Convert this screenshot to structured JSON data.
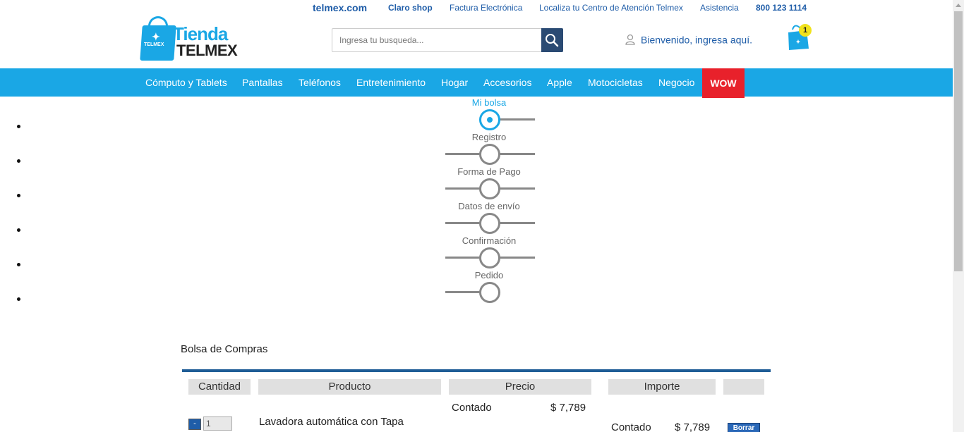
{
  "top_links": [
    {
      "label": "telmex.com"
    },
    {
      "label": "Claro shop"
    },
    {
      "label": "Factura Electrónica"
    },
    {
      "label": "Localiza tu Centro de Atención Telmex"
    },
    {
      "label": "Asistencia"
    },
    {
      "label": "800 123 1114"
    }
  ],
  "logo": {
    "line1": "Tienda",
    "line2": "TELMEX",
    "bag_text": "TELMEX"
  },
  "search": {
    "placeholder": "Ingresa tu busqueda...",
    "icon": "search-icon"
  },
  "account": {
    "label": "Bienvenido, ingresa aquí.",
    "icon": "user-icon"
  },
  "cart": {
    "count": "1",
    "icon": "shopping-bag-icon"
  },
  "nav": {
    "items": [
      {
        "label": "Cómputo y Tablets"
      },
      {
        "label": "Pantallas"
      },
      {
        "label": "Teléfonos"
      },
      {
        "label": "Entretenimiento"
      },
      {
        "label": "Hogar"
      },
      {
        "label": "Accesorios"
      },
      {
        "label": "Apple"
      },
      {
        "label": "Motocicletas"
      },
      {
        "label": "Negocio"
      }
    ],
    "highlight": {
      "label": "WOW"
    }
  },
  "steps": [
    {
      "label": "Mi bolsa",
      "active": true
    },
    {
      "label": "Registro",
      "active": false
    },
    {
      "label": "Forma de Pago",
      "active": false
    },
    {
      "label": "Datos de envío",
      "active": false
    },
    {
      "label": "Confirmación",
      "active": false
    },
    {
      "label": "Pedido",
      "active": false
    }
  ],
  "bag": {
    "title": "Bolsa de Compras",
    "headers": {
      "quantity": "Cantidad",
      "product": "Producto",
      "price": "Precio",
      "amount": "Importe"
    },
    "row": {
      "minus": "-",
      "quantity": "1",
      "product": "Lavadora automática con Tapa",
      "price_label": "Contado",
      "price_value": "$ 7,789",
      "amount_label": "Contado",
      "amount_value": "$ 7,789",
      "delete_label": "Borrar"
    }
  },
  "colors": {
    "brand_blue": "#1aa7e5",
    "link_blue": "#1f5da8",
    "wow_red": "#e8212b",
    "rule_blue": "#1f5d96"
  }
}
